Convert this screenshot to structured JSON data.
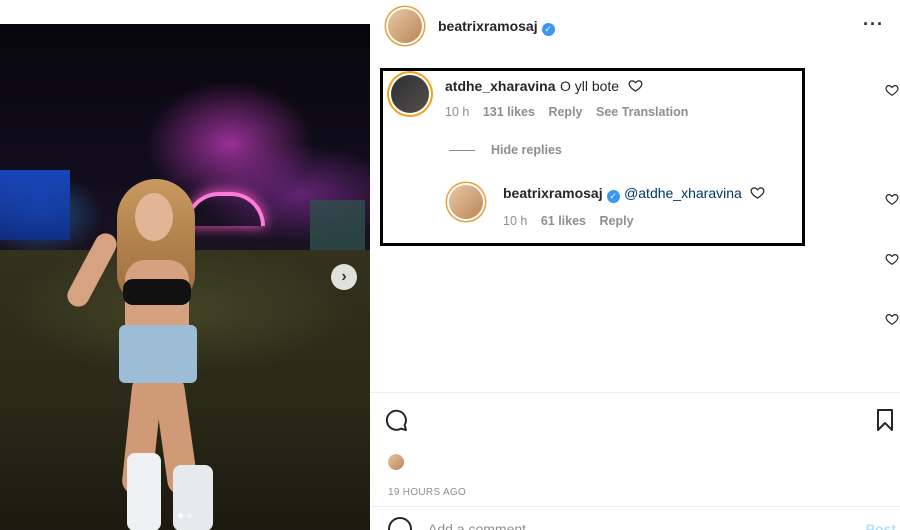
{
  "post": {
    "author": "beatrixramosaj",
    "timestamp": "19 HOURS AGO",
    "carousel_dots": 2,
    "carousel_active": 1
  },
  "comments": [
    {
      "username": "atdhe_xharavina",
      "text": "O yll bote",
      "time": "10 h",
      "likes": "131 likes",
      "reply_label": "Reply",
      "translate_label": "See Translation",
      "hide_replies_label": "Hide replies",
      "replies": [
        {
          "username": "beatrixramosaj",
          "mention": "@atdhe_xharavina",
          "time": "10 h",
          "likes": "61 likes",
          "reply_label": "Reply"
        }
      ]
    }
  ],
  "composer": {
    "placeholder": "Add a comment...",
    "post_label": "Post"
  },
  "icons": {
    "more": "more-options-icon",
    "verified": "verified-badge-icon",
    "heart": "heart-outline-icon",
    "next": "chevron-right-icon",
    "bookmark": "bookmark-icon",
    "comment": "comment-icon",
    "emoji": "emoji-icon"
  },
  "colors": {
    "verified": "#3897f0",
    "muted": "#8e8e8e",
    "mention": "#00376b",
    "post_disabled": "#b2dffc"
  }
}
